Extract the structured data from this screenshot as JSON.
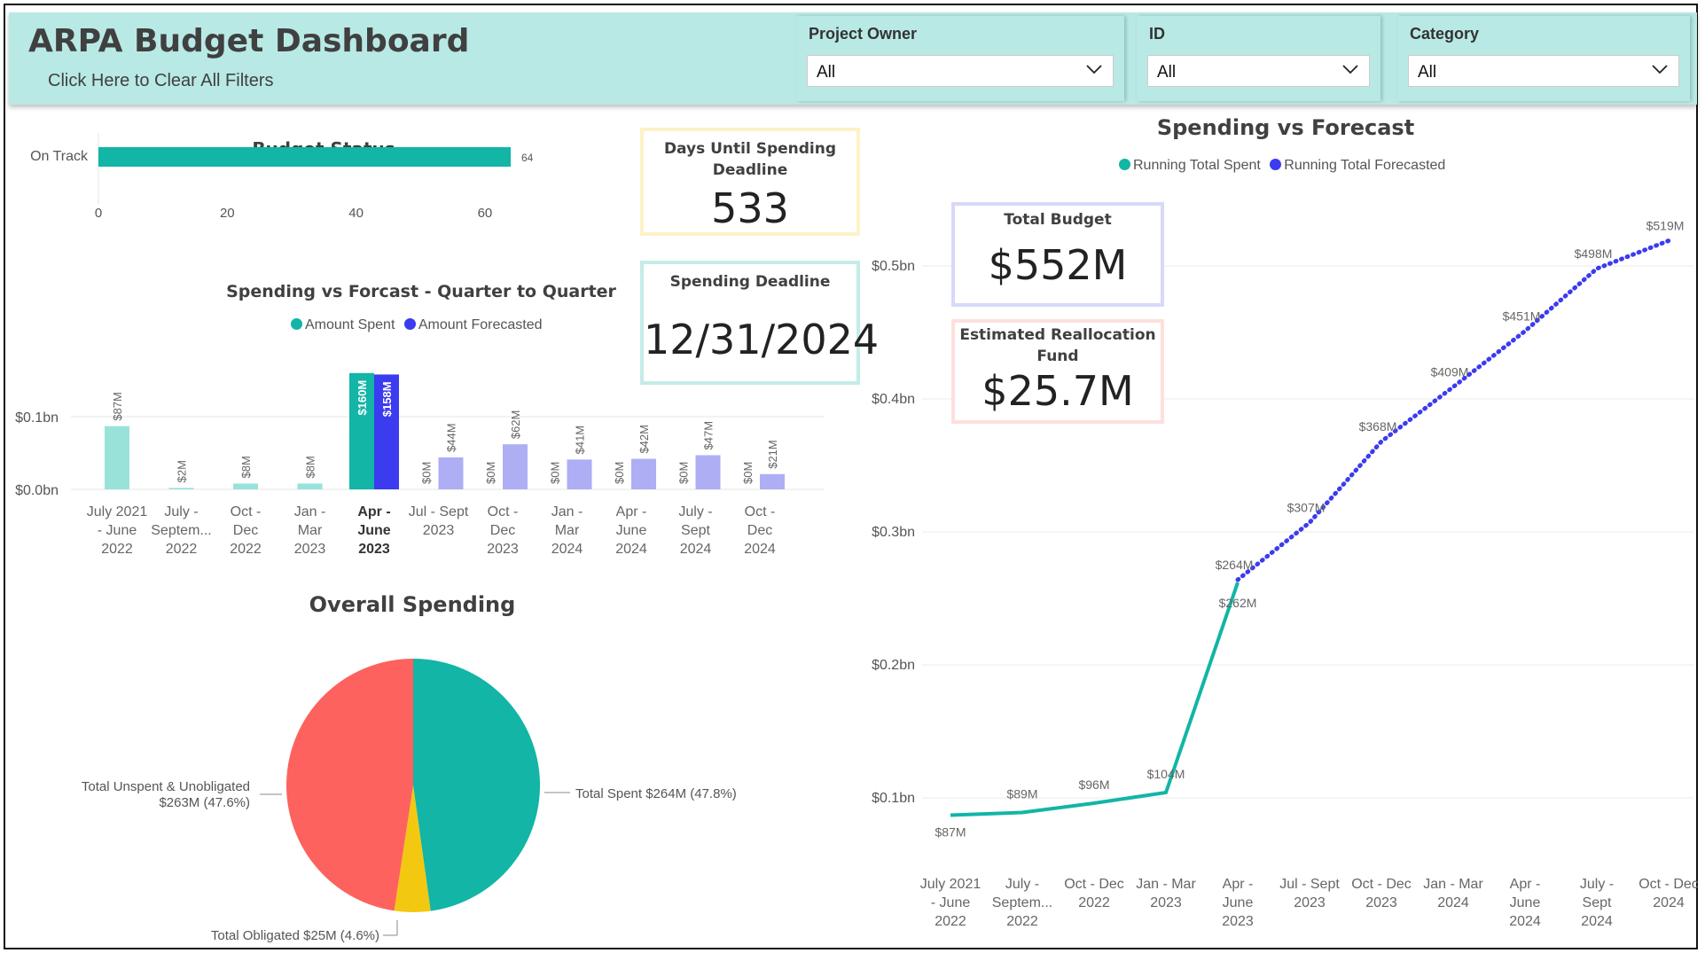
{
  "header": {
    "title": "ARPA Budget Dashboard",
    "clear_filters": "Click Here to Clear All Filters",
    "filters": [
      {
        "label": "Project Owner",
        "value": "All"
      },
      {
        "label": "ID",
        "value": "All"
      },
      {
        "label": "Category",
        "value": "All"
      }
    ]
  },
  "cards": {
    "days_until": {
      "title": "Days Until Spending Deadline",
      "value": "533"
    },
    "deadline": {
      "title": "Spending Deadline",
      "value": "12/31/2024"
    },
    "total_budget": {
      "title": "Total Budget",
      "value": "$552M"
    },
    "realloc": {
      "title": "Estimated Reallocation Fund",
      "value": "$25.7M"
    }
  },
  "colors": {
    "teal": "#12b5a6",
    "blue": "#3b3bf0",
    "teal_light": "#99e2da",
    "blue_light": "#aeaef5",
    "red": "#fd625e",
    "yellow": "#f2c811",
    "card_yellow_border": "#fdf2c8",
    "card_teal_border": "#c4ece8",
    "card_blue_border": "#d8d8fb",
    "card_red_border": "#fde0dc"
  },
  "chart_data": [
    {
      "id": "budget_status",
      "type": "bar",
      "orientation": "horizontal",
      "title": "Budget Status",
      "categories": [
        "On Track"
      ],
      "values": [
        64
      ],
      "data_labels": [
        "64"
      ],
      "xticks": [
        "0",
        "20",
        "40",
        "60"
      ],
      "xlim": [
        0,
        64
      ],
      "color": "#12b5a6"
    },
    {
      "id": "quarterly",
      "type": "bar",
      "title": "Spending vs Forcast - Quarter to Quarter",
      "legend": [
        "Amount Spent",
        "Amount Forecasted"
      ],
      "legend_position": "top",
      "yticks": [
        "$0.0bn",
        "$0.1bn"
      ],
      "ylim": [
        0,
        0.16
      ],
      "categories": [
        [
          "July 2021",
          "- June",
          "2022"
        ],
        [
          "July -",
          "Septem...",
          "2022"
        ],
        [
          "Oct -",
          "Dec",
          "2022"
        ],
        [
          "Jan -",
          "Mar",
          "2023"
        ],
        [
          "Apr -",
          "June",
          "2023"
        ],
        [
          "Jul - Sept",
          "2023"
        ],
        [
          "Oct -",
          "Dec",
          "2023"
        ],
        [
          "Jan -",
          "Mar",
          "2024"
        ],
        [
          "Apr -",
          "June",
          "2024"
        ],
        [
          "July -",
          "Sept",
          "2024"
        ],
        [
          "Oct -",
          "Dec",
          "2024"
        ]
      ],
      "highlight_index": 4,
      "series": [
        {
          "name": "Amount Spent",
          "values": [
            87,
            2,
            8,
            8,
            160,
            0,
            0,
            0,
            0,
            0,
            0
          ],
          "labels": [
            "$87M",
            "$2M",
            "$8M",
            "$8M",
            "$160M",
            "$0M",
            "$0M",
            "$0M",
            "$0M",
            "$0M",
            "$0M"
          ]
        },
        {
          "name": "Amount Forecasted",
          "values": [
            null,
            null,
            null,
            null,
            158,
            44,
            62,
            41,
            42,
            47,
            21
          ],
          "labels": [
            "",
            "",
            "",
            "",
            "$158M",
            "$44M",
            "$62M",
            "$41M",
            "$42M",
            "$47M",
            "$21M"
          ]
        }
      ]
    },
    {
      "id": "overall",
      "type": "pie",
      "title": "Overall Spending",
      "slices": [
        {
          "label": "Total Spent $264M (47.8%)",
          "value": 47.8,
          "color": "#12b5a6"
        },
        {
          "label": "Total Obligated $25M (4.6%)",
          "value": 4.6,
          "color": "#f2c811"
        },
        {
          "label": "Total Unspent & Unobligated",
          "label2": "$263M (47.6%)",
          "value": 47.6,
          "color": "#fd625e"
        }
      ]
    },
    {
      "id": "running",
      "type": "line",
      "title": "Spending vs Forecast",
      "legend": [
        "Running Total Spent",
        "Running Total Forecasted"
      ],
      "legend_position": "top",
      "yticks": [
        "$0.1bn",
        "$0.2bn",
        "$0.3bn",
        "$0.4bn",
        "$0.5bn"
      ],
      "ylim": [
        0.05,
        0.55
      ],
      "x": [
        [
          "July 2021",
          "- June",
          "2022"
        ],
        [
          "July -",
          "Septem...",
          "2022"
        ],
        [
          "Oct - Dec",
          "2022"
        ],
        [
          "Jan - Mar",
          "2023"
        ],
        [
          "Apr -",
          "June",
          "2023"
        ],
        [
          "Jul - Sept",
          "2023"
        ],
        [
          "Oct - Dec",
          "2023"
        ],
        [
          "Jan - Mar",
          "2024"
        ],
        [
          "Apr -",
          "June",
          "2024"
        ],
        [
          "July -",
          "Sept",
          "2024"
        ],
        [
          "Oct - Dec",
          "2024"
        ]
      ],
      "series": [
        {
          "name": "Running Total Spent",
          "values": [
            87,
            89,
            96,
            104,
            262,
            null,
            null,
            null,
            null,
            null,
            null
          ],
          "labels": [
            "$87M",
            "$89M",
            "$96M",
            "$104M",
            "$262M",
            "",
            "",
            "",
            "",
            "",
            ""
          ]
        },
        {
          "name": "Running Total Forecasted",
          "values": [
            null,
            null,
            null,
            null,
            264,
            307,
            368,
            409,
            451,
            498,
            519
          ],
          "labels": [
            "",
            "",
            "",
            "",
            "$264M",
            "$307M",
            "$368M",
            "$409M",
            "$451M",
            "$498M",
            "$519M"
          ]
        }
      ]
    }
  ]
}
